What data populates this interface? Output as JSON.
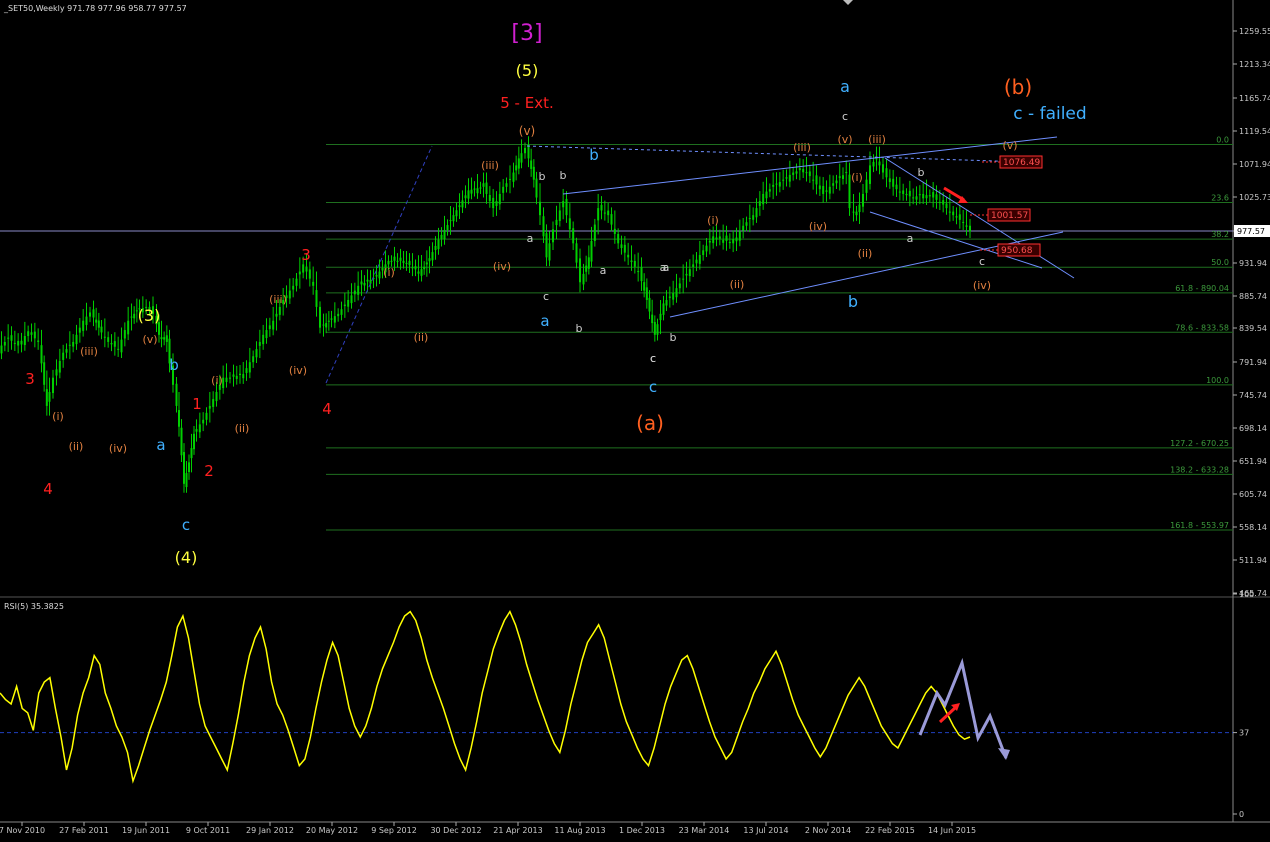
{
  "header": {
    "title": "_SET50,Weekly  971.78 977.96 958.77 977.57",
    "rsi_title": "RSI(5) 35.3825"
  },
  "colors": {
    "background": "#000000",
    "price_grid": "#3a3a3a",
    "candle": "#00d000",
    "fib": "#1f6f1f",
    "trendline": "#6f8fff",
    "rsi": "#ffff00",
    "projection": "#9a9ad8",
    "red_arrow": "#ff2020"
  },
  "chart_data": [
    {
      "type": "candlestick",
      "title": "_SET50,Weekly",
      "ohlc_last": {
        "open": 971.78,
        "high": 977.96,
        "low": 958.77,
        "close": 977.57
      },
      "current_price_label": "977.57",
      "y_ticks": [
        "1259.55",
        "1213.34",
        "1165.74",
        "1119.54",
        "1071.94",
        "1025.73",
        "977.57",
        "931.94",
        "885.74",
        "839.54",
        "791.94",
        "745.74",
        "698.14",
        "651.94",
        "605.74",
        "558.14",
        "511.94",
        "465.74"
      ],
      "y_tick_values": [
        1259.55,
        1213.34,
        1165.74,
        1119.54,
        1071.94,
        1025.73,
        977.57,
        931.94,
        885.74,
        839.54,
        791.94,
        745.74,
        698.14,
        651.94,
        605.74,
        558.14,
        511.94,
        465.74
      ],
      "ylim": [
        465.74,
        1280
      ],
      "x_ticks": [
        "7 Nov 2010",
        "27 Feb 2011",
        "19 Jun 2011",
        "9 Oct 2011",
        "29 Jan 2012",
        "20 May 2012",
        "9 Sep 2012",
        "30 Dec 2012",
        "21 Apr 2013",
        "11 Aug 2013",
        "1 Dec 2013",
        "23 Mar 2014",
        "13 Jul 2014",
        "2 Nov 2014",
        "22 Feb 2015",
        "14 Jun 2015"
      ],
      "price_path": [
        [
          0,
          810
        ],
        [
          10,
          825
        ],
        [
          20,
          815
        ],
        [
          30,
          835
        ],
        [
          40,
          820
        ],
        [
          48,
          730
        ],
        [
          55,
          770
        ],
        [
          65,
          805
        ],
        [
          75,
          820
        ],
        [
          85,
          850
        ],
        [
          92,
          862
        ],
        [
          100,
          840
        ],
        [
          110,
          820
        ],
        [
          120,
          810
        ],
        [
          130,
          850
        ],
        [
          138,
          865
        ],
        [
          148,
          870
        ],
        [
          155,
          860
        ],
        [
          160,
          830
        ],
        [
          168,
          820
        ],
        [
          175,
          760
        ],
        [
          180,
          700
        ],
        [
          185,
          620
        ],
        [
          190,
          650
        ],
        [
          195,
          690
        ],
        [
          205,
          710
        ],
        [
          215,
          740
        ],
        [
          225,
          770
        ],
        [
          232,
          770
        ],
        [
          245,
          775
        ],
        [
          255,
          800
        ],
        [
          265,
          830
        ],
        [
          275,
          850
        ],
        [
          285,
          880
        ],
        [
          295,
          900
        ],
        [
          305,
          930
        ],
        [
          315,
          900
        ],
        [
          322,
          840
        ],
        [
          330,
          850
        ],
        [
          340,
          860
        ],
        [
          350,
          880
        ],
        [
          360,
          900
        ],
        [
          375,
          910
        ],
        [
          390,
          935
        ],
        [
          405,
          935
        ],
        [
          420,
          920
        ],
        [
          428,
          930
        ],
        [
          440,
          965
        ],
        [
          455,
          1000
        ],
        [
          470,
          1035
        ],
        [
          485,
          1040
        ],
        [
          495,
          1010
        ],
        [
          505,
          1040
        ],
        [
          512,
          1050
        ],
        [
          520,
          1080
        ],
        [
          527,
          1095
        ],
        [
          535,
          1050
        ],
        [
          542,
          1000
        ],
        [
          548,
          940
        ],
        [
          555,
          980
        ],
        [
          565,
          1020
        ],
        [
          575,
          960
        ],
        [
          582,
          905
        ],
        [
          590,
          940
        ],
        [
          600,
          1010
        ],
        [
          610,
          1000
        ],
        [
          620,
          960
        ],
        [
          630,
          940
        ],
        [
          640,
          920
        ],
        [
          648,
          880
        ],
        [
          656,
          830
        ],
        [
          665,
          875
        ],
        [
          675,
          890
        ],
        [
          685,
          910
        ],
        [
          695,
          930
        ],
        [
          705,
          950
        ],
        [
          715,
          970
        ],
        [
          725,
          965
        ],
        [
          735,
          960
        ],
        [
          745,
          985
        ],
        [
          755,
          1000
        ],
        [
          765,
          1030
        ],
        [
          775,
          1040
        ],
        [
          785,
          1050
        ],
        [
          795,
          1060
        ],
        [
          805,
          1065
        ],
        [
          815,
          1050
        ],
        [
          825,
          1030
        ],
        [
          835,
          1045
        ],
        [
          848,
          1060
        ],
        [
          852,
          1010
        ],
        [
          858,
          1000
        ],
        [
          865,
          1030
        ],
        [
          872,
          1070
        ],
        [
          878,
          1080
        ],
        [
          885,
          1060
        ],
        [
          895,
          1040
        ],
        [
          905,
          1030
        ],
        [
          915,
          1025
        ],
        [
          925,
          1030
        ],
        [
          935,
          1025
        ],
        [
          945,
          1015
        ],
        [
          955,
          1000
        ],
        [
          965,
          990
        ],
        [
          972,
          977
        ]
      ],
      "fib_levels": [
        {
          "label": "0.0",
          "value": 1100
        },
        {
          "label": "23.6",
          "value": 1018
        },
        {
          "label": "38.2",
          "value": 966
        },
        {
          "label": "50.0",
          "value": 926
        },
        {
          "label": "61.8 - 890.04",
          "value": 890.04
        },
        {
          "label": "78.6 - 833.58",
          "value": 833.58
        },
        {
          "label": "100.0",
          "value": 760
        },
        {
          "label": "127.2 - 670.25",
          "value": 670.25
        },
        {
          "label": "138.2 - 633.28",
          "value": 633.28
        },
        {
          "label": "161.8 - 553.97",
          "value": 553.97
        }
      ],
      "price_boxes": [
        "1076.49",
        "1001.57",
        "950.68"
      ],
      "wave_labels": [
        {
          "text": "[3]",
          "color": "#d020d0",
          "size": 22
        },
        {
          "text": "(5)",
          "color": "#ffff40",
          "size": 16
        },
        {
          "text": "5 - Ext.",
          "color": "#ff2020",
          "size": 15
        },
        {
          "text": "(v)",
          "color": "#e08040",
          "size": 12
        },
        {
          "text": "(iii)",
          "color": "#e08040",
          "size": 11
        },
        {
          "text": "b",
          "color": "#d0d0d0",
          "size": 11
        },
        {
          "text": "a",
          "color": "#d0d0d0",
          "size": 11
        },
        {
          "text": "b",
          "color": "#40b0ff",
          "size": 15
        },
        {
          "text": "c",
          "color": "#d0d0d0",
          "size": 11
        },
        {
          "text": "b",
          "color": "#d0d0d0",
          "size": 11
        },
        {
          "text": "(iv)",
          "color": "#e08040",
          "size": 11
        },
        {
          "text": "a",
          "color": "#d0d0d0",
          "size": 11
        },
        {
          "text": "c",
          "color": "#d0d0d0",
          "size": 11
        },
        {
          "text": "a",
          "color": "#40b0ff",
          "size": 15
        },
        {
          "text": "a",
          "color": "#d0d0d0",
          "size": 11
        },
        {
          "text": "b",
          "color": "#d0d0d0",
          "size": 11
        },
        {
          "text": "a",
          "color": "#d0d0d0",
          "size": 11
        },
        {
          "text": "c",
          "color": "#d0d0d0",
          "size": 11
        },
        {
          "text": "b",
          "color": "#d0d0d0",
          "size": 11
        },
        {
          "text": "c",
          "color": "#40b0ff",
          "size": 15
        },
        {
          "text": "(a)",
          "color": "#ff6020",
          "size": 20
        },
        {
          "text": "(i)",
          "color": "#e08040",
          "size": 11
        },
        {
          "text": "(ii)",
          "color": "#e08040",
          "size": 11
        },
        {
          "text": "(iii)",
          "color": "#e08040",
          "size": 11
        },
        {
          "text": "(iv)",
          "color": "#e08040",
          "size": 11
        },
        {
          "text": "a",
          "color": "#40b0ff",
          "size": 16
        },
        {
          "text": "c",
          "color": "#d0d0d0",
          "size": 11
        },
        {
          "text": "(v)",
          "color": "#e08040",
          "size": 11
        },
        {
          "text": "(iii)",
          "color": "#e08040",
          "size": 11
        },
        {
          "text": "(i)",
          "color": "#e08040",
          "size": 11
        },
        {
          "text": "(ii)",
          "color": "#e08040",
          "size": 11
        },
        {
          "text": "b",
          "color": "#40b0ff",
          "size": 16
        },
        {
          "text": "b",
          "color": "#d0d0d0",
          "size": 11
        },
        {
          "text": "a",
          "color": "#d0d0d0",
          "size": 11
        },
        {
          "text": "c",
          "color": "#d0d0d0",
          "size": 11
        },
        {
          "text": "(iv)",
          "color": "#e08040",
          "size": 11
        },
        {
          "text": "(v)",
          "color": "#e08040",
          "size": 11
        },
        {
          "text": "(b)",
          "color": "#ff6020",
          "size": 20
        },
        {
          "text": "c - failed",
          "color": "#40b0ff",
          "size": 17
        },
        {
          "text": "3",
          "color": "#ff2020",
          "size": 15
        },
        {
          "text": "4",
          "color": "#ff2020",
          "size": 15
        },
        {
          "text": "(i)",
          "color": "#e08040",
          "size": 11
        },
        {
          "text": "(ii)",
          "color": "#e08040",
          "size": 11
        },
        {
          "text": "(iii)",
          "color": "#e08040",
          "size": 11
        },
        {
          "text": "(iv)",
          "color": "#e08040",
          "size": 11
        },
        {
          "text": "(3)",
          "color": "#ffff40",
          "size": 16
        },
        {
          "text": "(v)",
          "color": "#e08040",
          "size": 11
        },
        {
          "text": "b",
          "color": "#40b0ff",
          "size": 15
        },
        {
          "text": "a",
          "color": "#40b0ff",
          "size": 15
        },
        {
          "text": "1",
          "color": "#ff2020",
          "size": 15
        },
        {
          "text": "2",
          "color": "#ff2020",
          "size": 15
        },
        {
          "text": "(i)",
          "color": "#e08040",
          "size": 11
        },
        {
          "text": "(ii)",
          "color": "#e08040",
          "size": 11
        },
        {
          "text": "c",
          "color": "#40b0ff",
          "size": 15
        },
        {
          "text": "(4)",
          "color": "#ffff40",
          "size": 16
        },
        {
          "text": "(iii)",
          "color": "#e08040",
          "size": 11
        },
        {
          "text": "(iv)",
          "color": "#e08040",
          "size": 11
        },
        {
          "text": "3",
          "color": "#ff2020",
          "size": 15
        },
        {
          "text": "4",
          "color": "#ff2020",
          "size": 15
        },
        {
          "text": "(i)",
          "color": "#e08040",
          "size": 11
        },
        {
          "text": "(ii)",
          "color": "#e08040",
          "size": 11
        }
      ]
    },
    {
      "type": "line",
      "title": "RSI(5) 35.3825",
      "y_ticks": [
        "100",
        "37",
        "0"
      ],
      "y_tick_values": [
        100,
        37,
        0
      ],
      "ylim": [
        0,
        100
      ],
      "reference_level": 37,
      "values": [
        55,
        52,
        50,
        58,
        48,
        46,
        38,
        55,
        60,
        62,
        48,
        35,
        20,
        30,
        45,
        55,
        62,
        72,
        68,
        55,
        48,
        40,
        35,
        28,
        15,
        22,
        30,
        38,
        45,
        52,
        60,
        72,
        85,
        90,
        80,
        65,
        50,
        40,
        35,
        30,
        25,
        20,
        32,
        45,
        60,
        72,
        80,
        85,
        75,
        60,
        50,
        45,
        38,
        30,
        22,
        25,
        35,
        48,
        60,
        70,
        78,
        72,
        60,
        48,
        40,
        35,
        40,
        48,
        58,
        66,
        72,
        78,
        85,
        90,
        92,
        88,
        80,
        70,
        62,
        55,
        48,
        40,
        32,
        25,
        20,
        30,
        42,
        55,
        65,
        75,
        82,
        88,
        92,
        86,
        78,
        68,
        60,
        52,
        45,
        38,
        32,
        28,
        38,
        50,
        60,
        70,
        78,
        82,
        86,
        80,
        70,
        60,
        50,
        42,
        36,
        30,
        25,
        22,
        30,
        40,
        50,
        58,
        64,
        70,
        72,
        66,
        58,
        50,
        42,
        35,
        30,
        25,
        28,
        35,
        42,
        48,
        55,
        60,
        66,
        70,
        74,
        68,
        60,
        52,
        45,
        40,
        35,
        30,
        26,
        30,
        36,
        42,
        48,
        54,
        58,
        62,
        58,
        52,
        46,
        40,
        36,
        32,
        30,
        35,
        40,
        45,
        50,
        55,
        58,
        55,
        50,
        45,
        40,
        36,
        34,
        35
      ]
    }
  ]
}
